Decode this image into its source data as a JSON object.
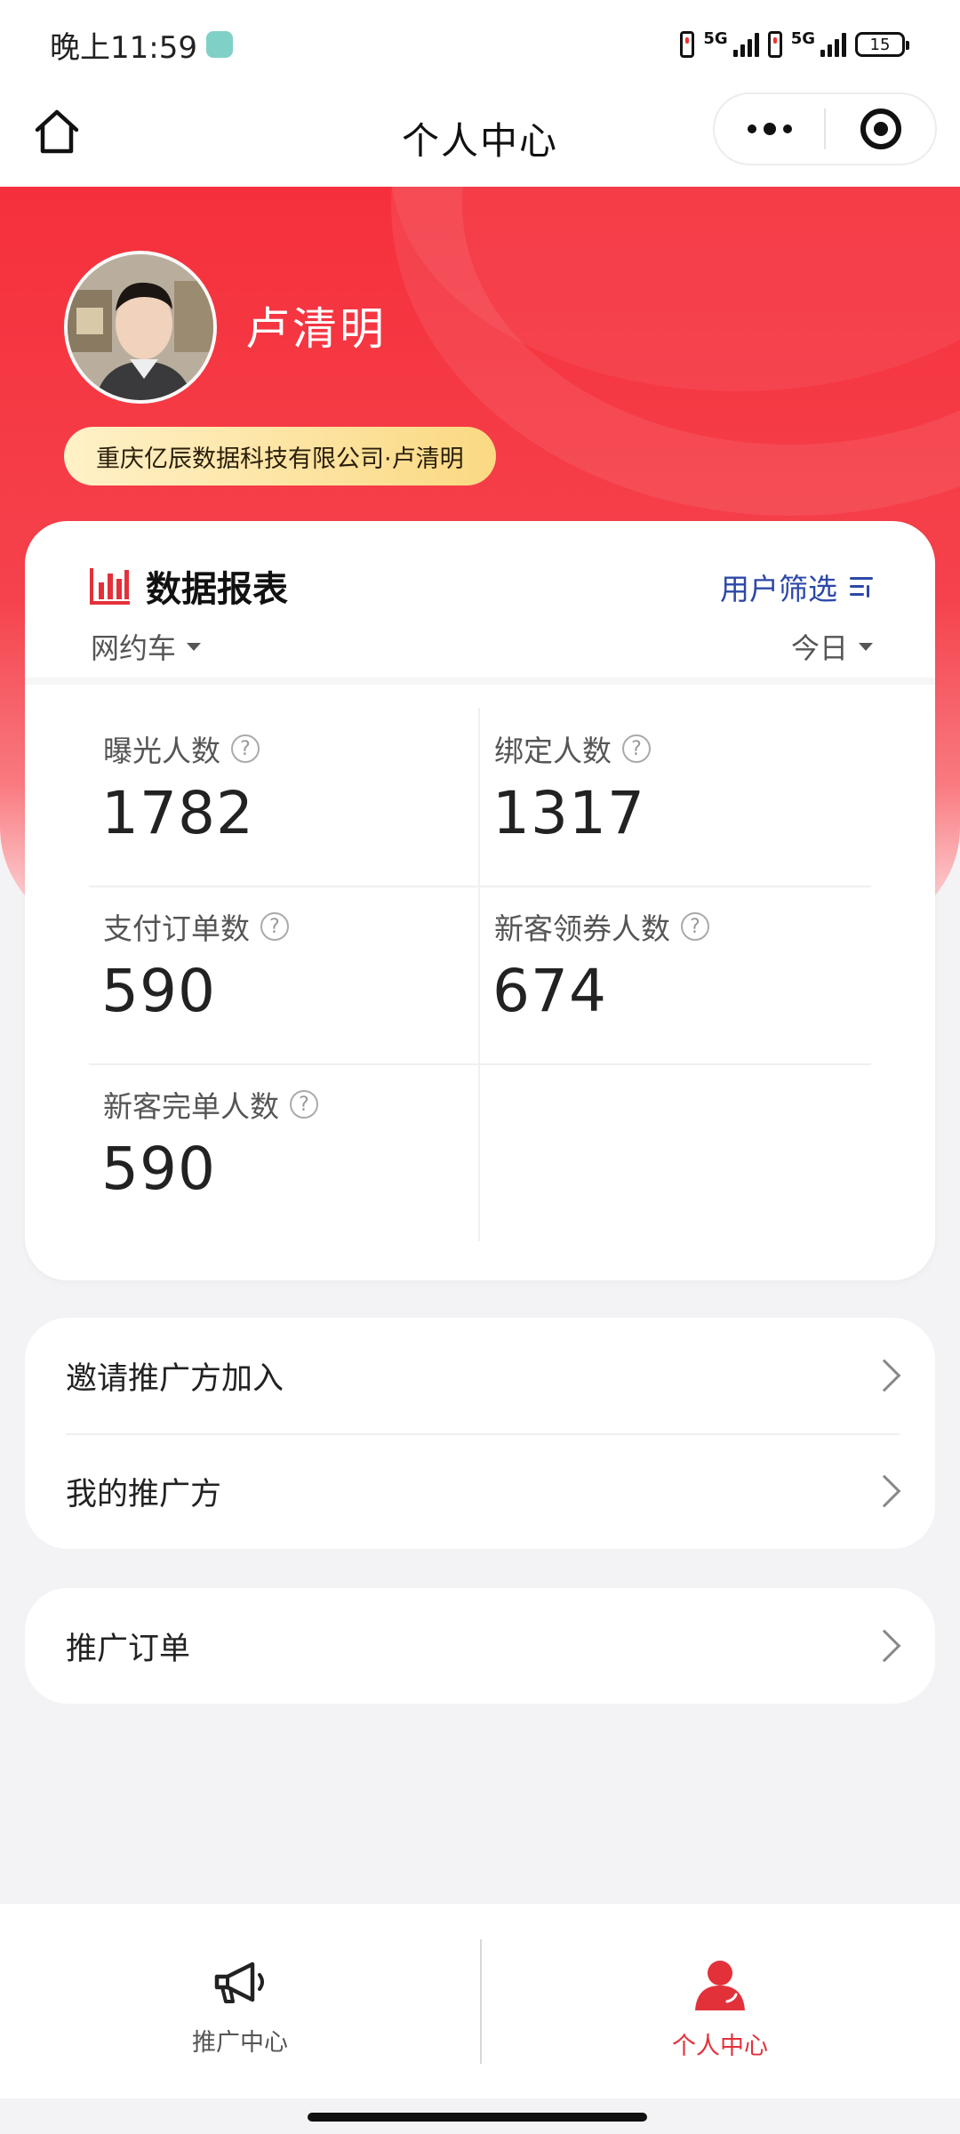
{
  "status_bar": {
    "time": "晚上11:59",
    "net_left": "5G",
    "net_right": "5G",
    "battery": "15"
  },
  "nav": {
    "title": "个人中心"
  },
  "profile": {
    "name": "卢清明",
    "company": "重庆亿辰数据科技有限公司·卢清明"
  },
  "report": {
    "title": "数据报表",
    "filter_label": "用户筛选",
    "category": "网约车",
    "period": "今日",
    "stats": [
      {
        "label": "曝光人数",
        "value": "1782"
      },
      {
        "label": "绑定人数",
        "value": "1317"
      },
      {
        "label": "支付订单数",
        "value": "590"
      },
      {
        "label": "新客领券人数",
        "value": "674"
      },
      {
        "label": "新客完单人数",
        "value": "590"
      }
    ]
  },
  "menu_group1": [
    {
      "label": "邀请推广方加入"
    },
    {
      "label": "我的推广方"
    }
  ],
  "menu_group2": [
    {
      "label": "推广订单"
    }
  ],
  "tabs": [
    {
      "label": "推广中心"
    },
    {
      "label": "个人中心"
    }
  ],
  "colors": {
    "brand_red": "#f5303c",
    "link_blue": "#2c48a8",
    "tag_gold": "#fbd983"
  },
  "icons": [
    "home-icon",
    "more-dots-icon",
    "capsule-target-icon",
    "bar-chart-icon",
    "filter-icon",
    "help-icon",
    "chevron-right-icon",
    "megaphone-icon",
    "person-icon"
  ]
}
